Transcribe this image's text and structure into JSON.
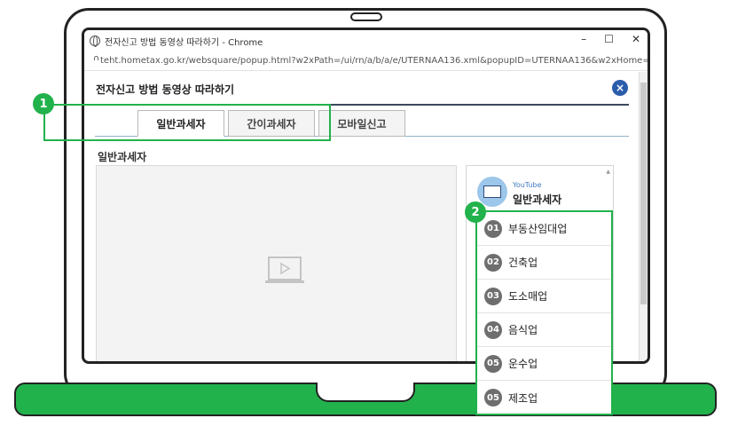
{
  "browser": {
    "window_title": "전자신고 방법 동영상 따라하기 - Chrome",
    "url": "teht.hometax.go.kr/websquare/popup.html?w2xPath=/ui/rn/a/b/a/e/UTERNAA136.xml&popupID=UTERNAA136&w2xHome=/u...",
    "controls": {
      "minimize": "–",
      "maximize": "☐",
      "close": "✕"
    }
  },
  "page": {
    "title": "전자신고 방법 동영상 따라하기",
    "close_label": "×"
  },
  "tabs": [
    {
      "label": "일반과세자",
      "active": true
    },
    {
      "label": "간이과세자",
      "active": false
    },
    {
      "label": "모바일신고",
      "active": false
    }
  ],
  "section_title": "일반과세자",
  "playlist": {
    "source": "YouTube",
    "title": "일반과세자",
    "items": [
      {
        "num": "01",
        "label": "부동산임대업"
      },
      {
        "num": "02",
        "label": "건축업"
      },
      {
        "num": "03",
        "label": "도소매업"
      },
      {
        "num": "04",
        "label": "음식업"
      },
      {
        "num": "05",
        "label": "운수업"
      },
      {
        "num": "05",
        "label": "제조업"
      }
    ]
  },
  "callouts": {
    "one": "1",
    "two": "2"
  },
  "colors": {
    "accent_green": "#22b24c",
    "close_blue": "#2a5dab",
    "badge_gray": "#6e6e6e"
  },
  "icons": {
    "browser": "globe-icon",
    "address": "lock-icon",
    "video": "video-player-icon",
    "playlist": "youtube-monitor-icon"
  }
}
